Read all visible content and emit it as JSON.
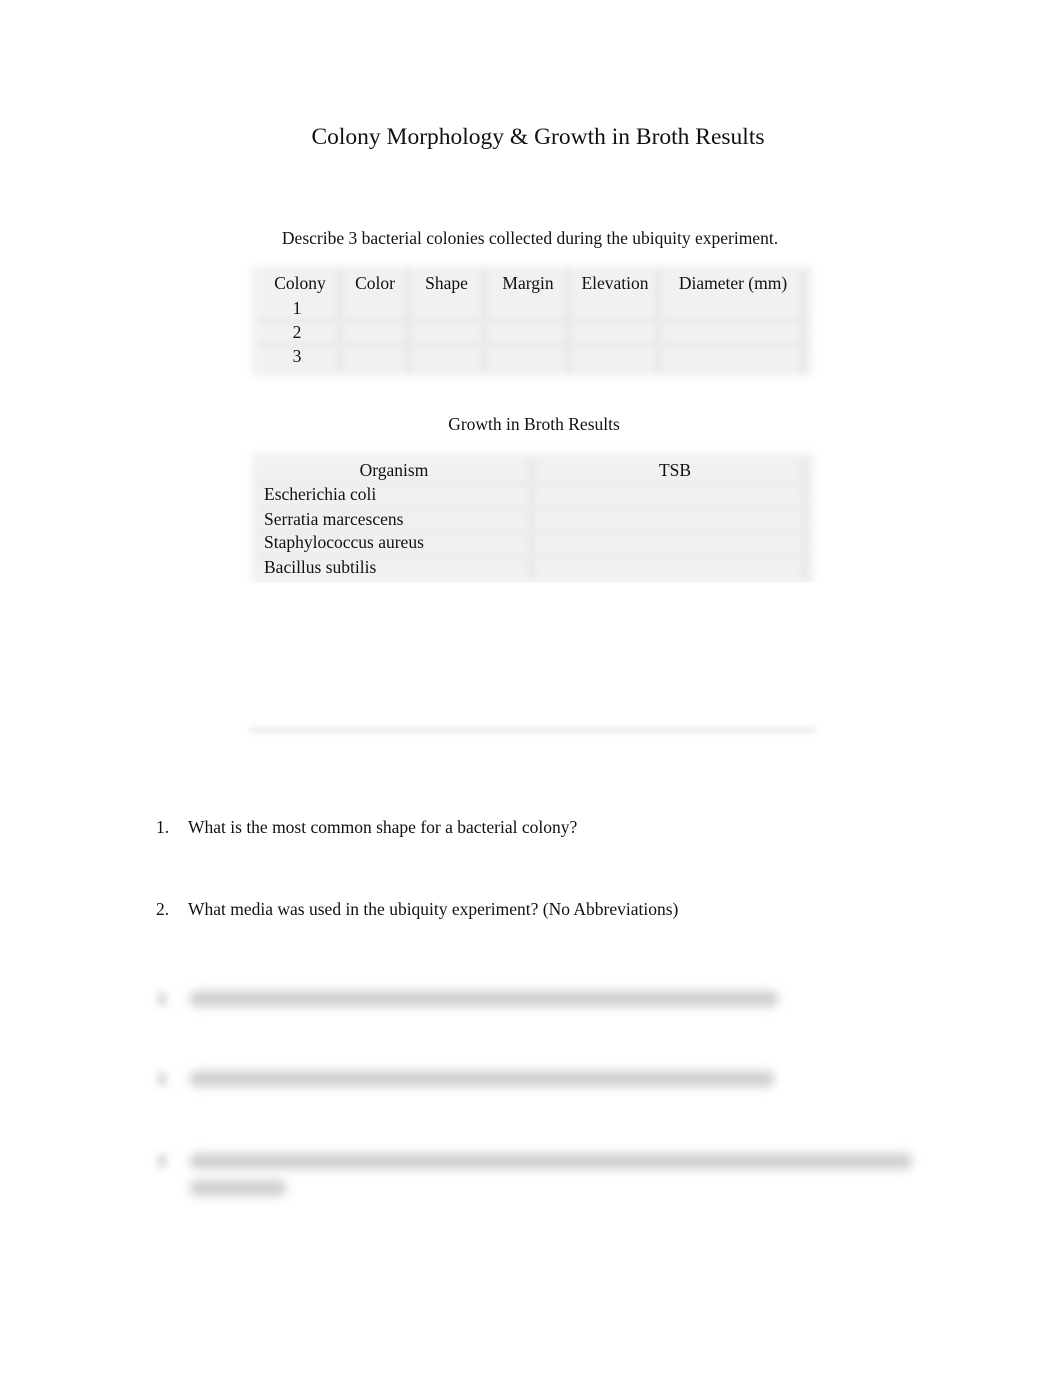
{
  "title": "Colony Morphology & Growth in Broth Results",
  "instruction": "Describe 3 bacterial colonies collected during the ubiquity experiment.",
  "colony_table": {
    "headers": [
      "Colony",
      "Color",
      "Shape",
      "Margin",
      "Elevation",
      "Diameter (mm)"
    ],
    "rows": [
      {
        "colony": "1",
        "color": "",
        "shape": "",
        "margin": "",
        "elevation": "",
        "diameter": ""
      },
      {
        "colony": "2",
        "color": "",
        "shape": "",
        "margin": "",
        "elevation": "",
        "diameter": ""
      },
      {
        "colony": "3",
        "color": "",
        "shape": "",
        "margin": "",
        "elevation": "",
        "diameter": ""
      }
    ]
  },
  "broth_section": {
    "title": "Growth in Broth Results",
    "headers": [
      "Organism",
      "TSB"
    ],
    "rows": [
      {
        "organism": "Escherichia coli",
        "tsb": ""
      },
      {
        "organism": "Serratia marcescens",
        "tsb": ""
      },
      {
        "organism": "Staphylococcus aureus",
        "tsb": ""
      },
      {
        "organism": "Bacillus subtilis",
        "tsb": ""
      }
    ]
  },
  "questions": [
    {
      "number": "1.",
      "text": "What is the most common shape for a bacterial colony?",
      "blurred": false
    },
    {
      "number": "2.",
      "text": "What media was used in the ubiquity experiment? (No Abbreviations)",
      "blurred": false
    },
    {
      "number": "3.",
      "text": "",
      "blurred": true
    },
    {
      "number": "4.",
      "text": "",
      "blurred": true
    },
    {
      "number": "5.",
      "text": "",
      "blurred": true
    }
  ]
}
